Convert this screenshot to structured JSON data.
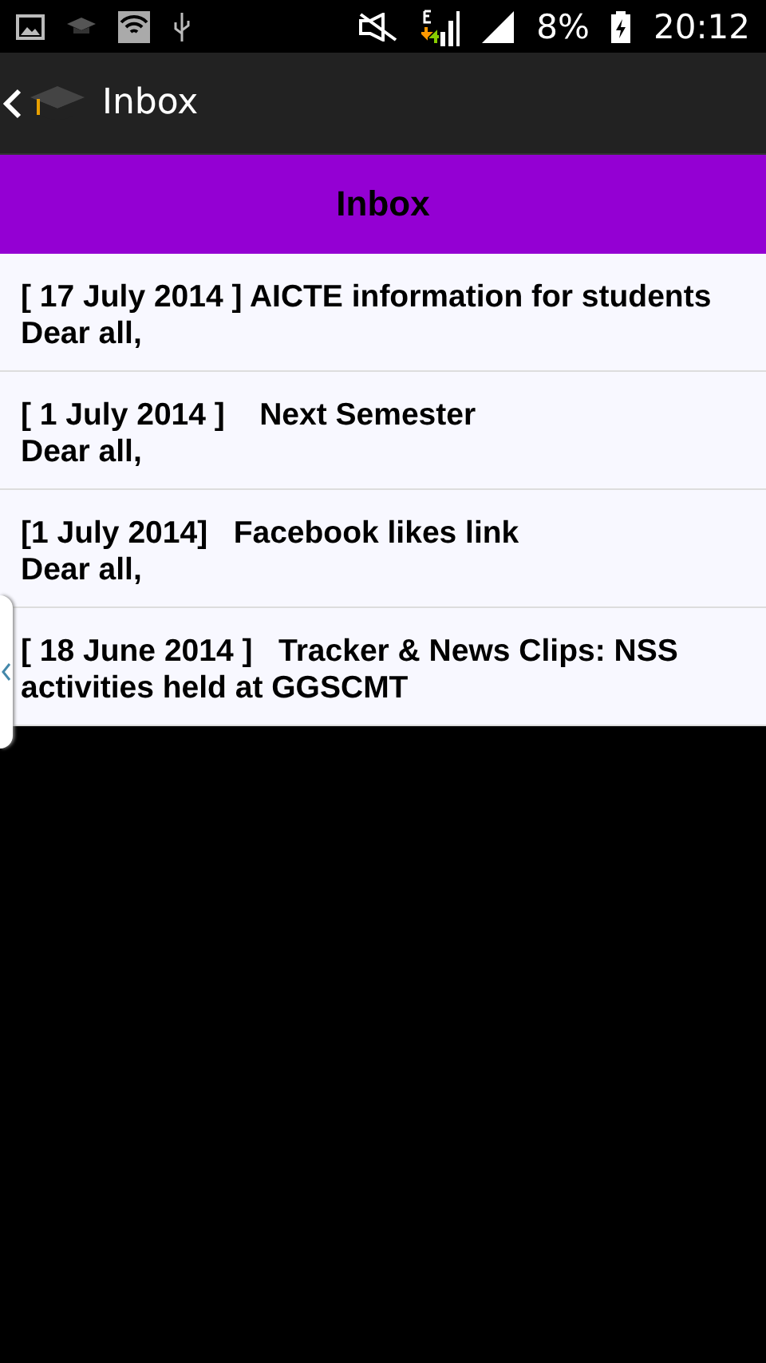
{
  "status_bar": {
    "battery": "8%",
    "time": "20:12"
  },
  "action_bar": {
    "title": "Inbox"
  },
  "header": {
    "title": "Inbox"
  },
  "messages": [
    {
      "title": "[ 17 July 2014 ] AICTE information for students",
      "preview": "Dear all,"
    },
    {
      "title": "[ 1 July 2014 ]    Next Semester",
      "preview": "Dear all,"
    },
    {
      "title": "[1 July 2014]   Facebook likes link",
      "preview": "Dear all,"
    },
    {
      "title": "[ 18 June 2014 ]   Tracker & News Clips: NSS activities held at GGSCMT"
    }
  ]
}
